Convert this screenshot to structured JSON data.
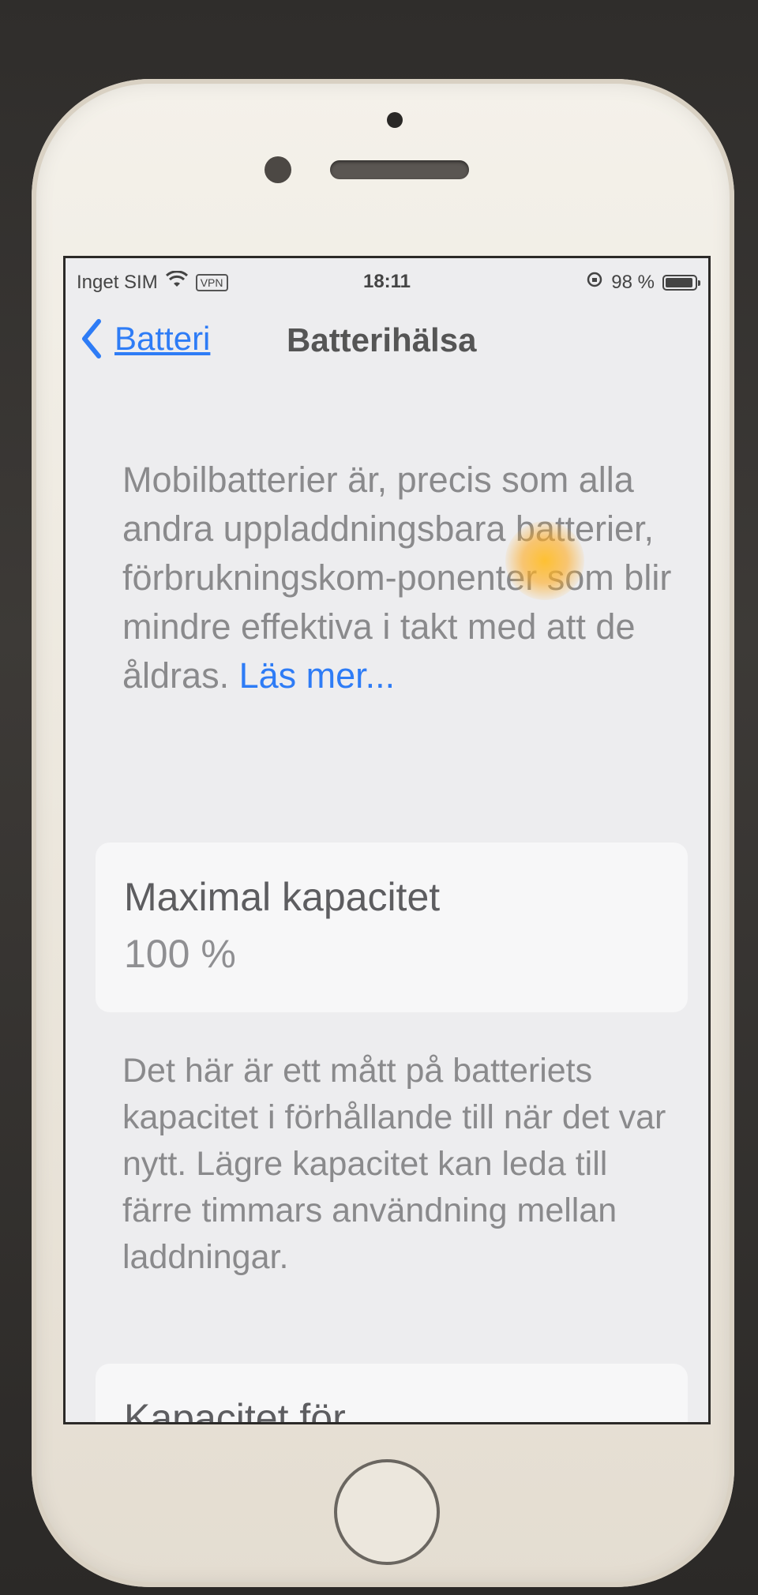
{
  "status_bar": {
    "carrier": "Inget SIM",
    "vpn_label": "VPN",
    "time": "18:11",
    "battery_percent": "98 %",
    "icons": [
      "wifi-icon",
      "vpn-badge",
      "rotation-lock-icon",
      "battery-icon"
    ]
  },
  "nav": {
    "back_label": "Batteri",
    "title": "Batterihälsa"
  },
  "intro": {
    "text": "Mobilbatterier är, precis som alla andra uppladdningsbara batterier, förbrukningskom-ponenter som blir mindre effektiva i takt med att de åldras. ",
    "link": "Läs mer..."
  },
  "capacity": {
    "title": "Maximal kapacitet",
    "value": "100 %",
    "description": "Det här är ett mått på batteriets kapacitet i förhållande till när det var nytt. Lägre kapacitet kan leda till färre timmars användning mellan laddningar."
  },
  "next_section": {
    "title": "Kapacitet för"
  },
  "colors": {
    "accent": "#2e7cf6",
    "screen_bg": "#ededef",
    "card_bg": "#f7f7f8"
  }
}
